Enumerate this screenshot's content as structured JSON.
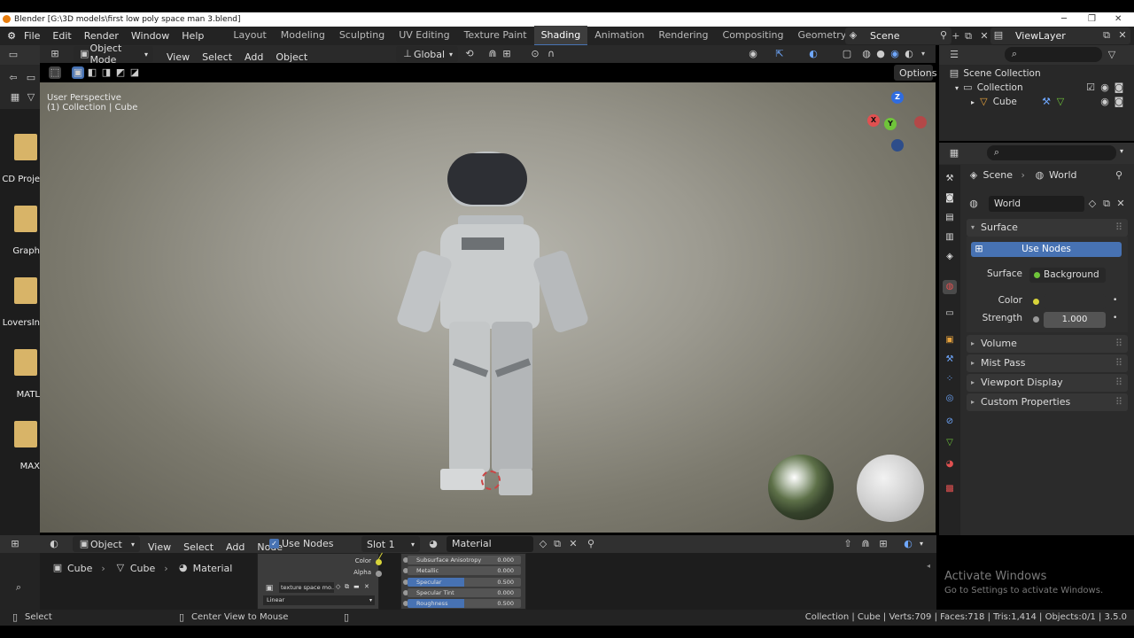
{
  "window": {
    "title": "Blender [G:\\3D models\\first low poly space man 3.blend]"
  },
  "menu": [
    "File",
    "Edit",
    "Render",
    "Window",
    "Help"
  ],
  "workspaces": [
    {
      "label": "Layout",
      "active": false
    },
    {
      "label": "Modeling",
      "active": false
    },
    {
      "label": "Sculpting",
      "active": false
    },
    {
      "label": "UV Editing",
      "active": false
    },
    {
      "label": "Texture Paint",
      "active": false
    },
    {
      "label": "Shading",
      "active": true
    },
    {
      "label": "Animation",
      "active": false
    },
    {
      "label": "Rendering",
      "active": false
    },
    {
      "label": "Compositing",
      "active": false
    },
    {
      "label": "Geometry Nodes",
      "active": false
    },
    {
      "label": "Scripting",
      "active": false
    }
  ],
  "scene": {
    "name": "Scene"
  },
  "viewlayer": {
    "name": "ViewLayer"
  },
  "viewport_header": {
    "mode": "Object Mode",
    "menus": [
      "View",
      "Select",
      "Add",
      "Object"
    ],
    "orientation": "Global",
    "options_label": "Options"
  },
  "viewport": {
    "perspective_label": "User Perspective",
    "collection_label": "(1) Collection | Cube",
    "gizmo": {
      "z": "Z",
      "x": "X",
      "y": "Y"
    }
  },
  "file_browser": {
    "folders": [
      "CD Proje",
      "Graph",
      "LoversIn",
      "MATL",
      "MAX"
    ]
  },
  "outliner": {
    "root": "Scene Collection",
    "collection": "Collection",
    "object": "Cube"
  },
  "properties": {
    "breadcrumb": [
      "Scene",
      "World"
    ],
    "world_name": "World",
    "surface_panel": "Surface",
    "use_nodes_label": "Use Nodes",
    "surface_label": "Surface",
    "surface_value": "Background",
    "color_label": "Color",
    "strength_label": "Strength",
    "strength_value": "1.000",
    "collapsed_panels": [
      "Volume",
      "Mist Pass",
      "Viewport Display",
      "Custom Properties"
    ]
  },
  "node_header": {
    "editor": "Object",
    "menus": [
      "View",
      "Select",
      "Add",
      "Node"
    ],
    "use_nodes": "Use Nodes",
    "slot": "Slot 1",
    "material": "Material"
  },
  "node_breadcrumb": [
    "Cube",
    "Cube",
    "Material"
  ],
  "image_node": {
    "outputs": [
      "Color",
      "Alpha"
    ],
    "image_name": "texture space mo...",
    "interpolation": "Linear"
  },
  "bsdf_sockets": [
    {
      "label": "Subsurface Anisotropy",
      "value": "0.000",
      "highlight": false
    },
    {
      "label": "Metallic",
      "value": "0.000",
      "highlight": false
    },
    {
      "label": "Specular",
      "value": "0.500",
      "highlight": true
    },
    {
      "label": "Specular Tint",
      "value": "0.000",
      "highlight": false
    },
    {
      "label": "Roughness",
      "value": "0.500",
      "highlight": true
    }
  ],
  "statusbar": {
    "left": "Select",
    "middle": "Center View to Mouse",
    "right": "Collection | Cube | Verts:709 | Faces:718 | Tris:1,414 | Objects:0/1 | 3.5.0"
  },
  "watermark": {
    "title": "Activate Windows",
    "subtitle": "Go to Settings to activate Windows."
  },
  "colors": {
    "accent": "#4772b3",
    "header": "#303030",
    "background": "#1d1d1d"
  }
}
